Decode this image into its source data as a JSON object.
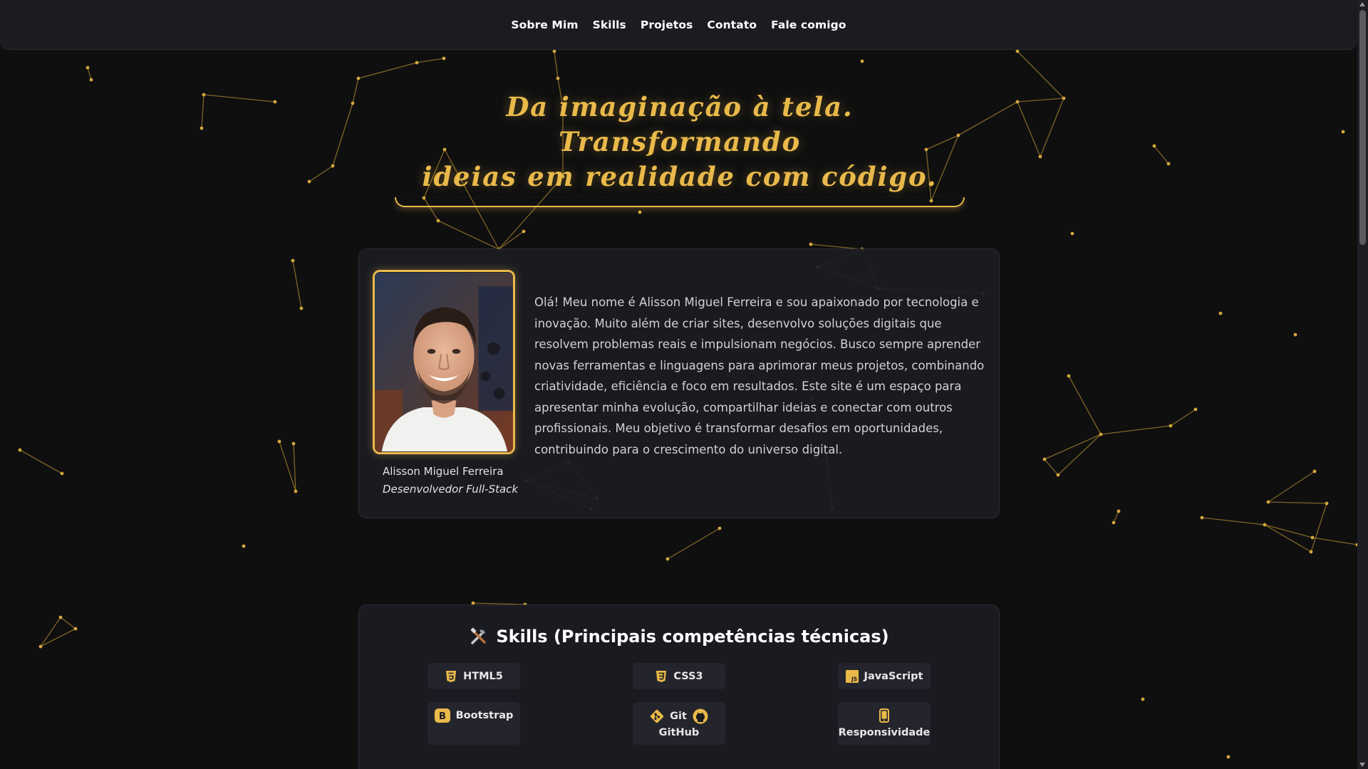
{
  "nav": {
    "items": [
      {
        "label": "Sobre Mim"
      },
      {
        "label": "Skills"
      },
      {
        "label": "Projetos"
      },
      {
        "label": "Contato"
      }
    ],
    "cta": "Fale comigo"
  },
  "hero": {
    "line1": "Da imaginação à tela. Transformando",
    "line2": "ideias em realidade com código."
  },
  "about": {
    "name": "Alisson Miguel Ferreira",
    "role": "Desenvolvedor Full-Stack",
    "bio": "Olá! Meu nome é Alisson Miguel Ferreira e sou apaixonado por tecnologia e inovação. Muito além de criar sites, desenvolvo soluções digitais que resolvem problemas reais e impulsionam negócios. Busco sempre aprender novas ferramentas e linguagens para aprimorar meus projetos, combinando criatividade, eficiência e foco em resultados. Este site é um espaço para apresentar minha evolução, compartilhar ideias e conectar com outros profissionais. Meu objetivo é transformar desafios em oportunidades, contribuindo para o crescimento do universo digital."
  },
  "skills": {
    "title": "Skills (Principais competências técnicas)",
    "title_icon": "tools-icon",
    "items": [
      {
        "label": "HTML5",
        "icon": "html5-icon"
      },
      {
        "label": "CSS3",
        "icon": "css3-icon"
      },
      {
        "label": "JavaScript",
        "icon": "javascript-icon"
      },
      {
        "label": "Bootstrap",
        "icon": "bootstrap-icon"
      },
      {
        "label": "Git",
        "label2": "GitHub",
        "icon": "git-icon",
        "icon2": "github-icon"
      },
      {
        "label": "Responsividade",
        "icon": "mobile-icon"
      }
    ]
  },
  "colors": {
    "accent": "#e9b94a",
    "background": "#0f0f10",
    "card": "#1b1c22"
  }
}
